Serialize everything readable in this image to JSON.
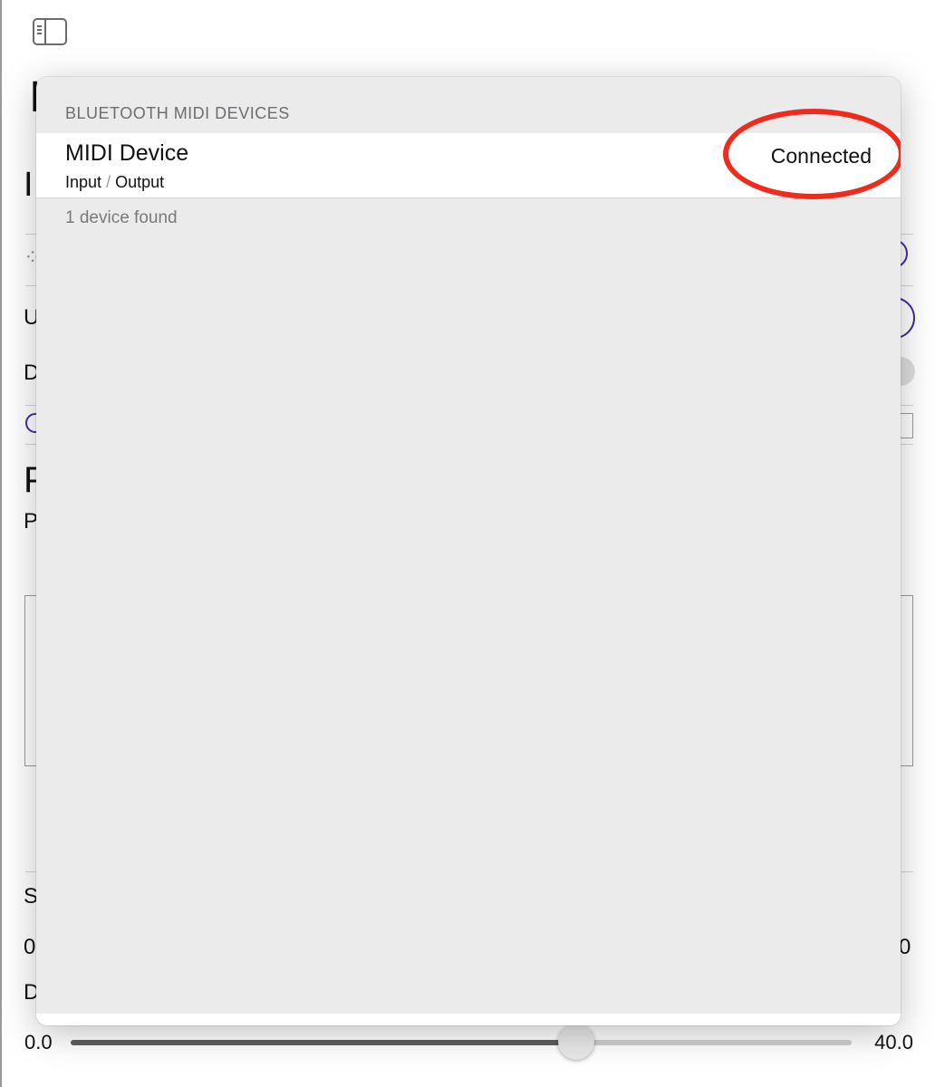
{
  "background": {
    "sidebar_toggle_icon": "sidebar-left-icon",
    "fragments": [
      "I",
      "I",
      "U",
      "D",
      "P",
      "P",
      "S",
      "0",
      "0",
      "D"
    ],
    "slider": {
      "min_label": "0.0",
      "max_label": "40.0",
      "value": 25.9,
      "min": 0,
      "max": 40
    }
  },
  "popover": {
    "section_header": "BLUETOOTH MIDI DEVICES",
    "device": {
      "name": "MIDI Device",
      "input_label": "Input",
      "separator": "/",
      "output_label": "Output",
      "status": "Connected"
    },
    "footer": "1 device found"
  },
  "annotation": {
    "color": "#ef2b1c",
    "shape": "ellipse"
  },
  "colors": {
    "accent": "#4a2aa0",
    "popover_bg": "#ebebeb"
  }
}
